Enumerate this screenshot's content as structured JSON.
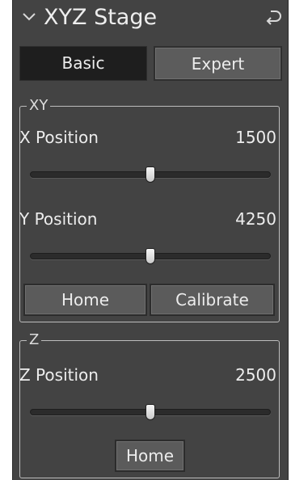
{
  "panel": {
    "title": "XYZ Stage",
    "collapse_icon": "chevron-down-icon",
    "reset_icon": "undo-icon"
  },
  "tabs": [
    {
      "label": "Basic",
      "selected": true
    },
    {
      "label": "Expert",
      "selected": false
    }
  ],
  "xy_group": {
    "title": "XY",
    "x": {
      "label": "X Position",
      "value": "1500",
      "slider_fraction": 0.5
    },
    "y": {
      "label": "Y Position",
      "value": "4250",
      "slider_fraction": 0.5
    },
    "home_label": "Home",
    "calibrate_label": "Calibrate"
  },
  "z_group": {
    "title": "Z",
    "z": {
      "label": "Z Position",
      "value": "2500",
      "slider_fraction": 0.5
    },
    "home_label": "Home"
  },
  "colors": {
    "panel_bg": "#434343",
    "selected_tab_bg": "#1e1e1e",
    "button_bg": "#5b5b5b",
    "text": "#ececec"
  }
}
